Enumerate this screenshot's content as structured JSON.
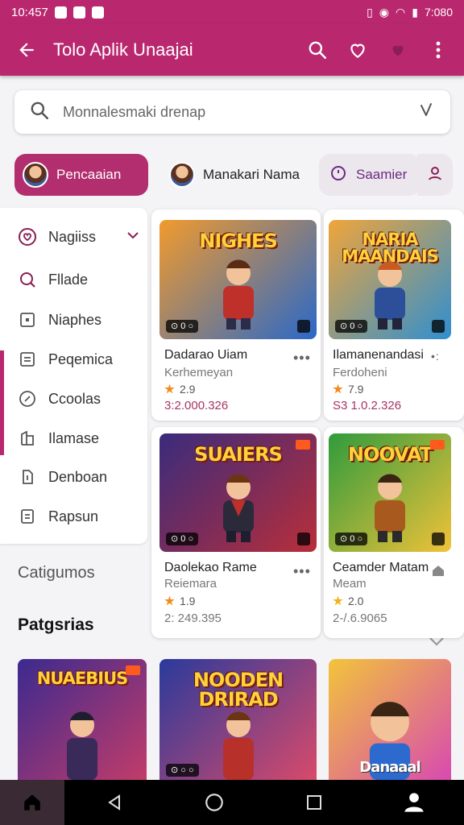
{
  "status": {
    "time": "10:457",
    "right_text": "7:080"
  },
  "appbar": {
    "title": "Tolo Aplik Unaajai",
    "icons": [
      "back-arrow-icon",
      "search-icon",
      "heart-icon",
      "heart-badge-icon",
      "more-vert-icon"
    ]
  },
  "search": {
    "value": "Monnalesmaki drenap",
    "icon": "search-icon",
    "mic_icon": "mic-icon"
  },
  "chips": [
    {
      "label": "Pencaaian",
      "selected": true
    },
    {
      "label": "Manakari Nama",
      "selected": false
    },
    {
      "label": "Saamier",
      "selected": false
    }
  ],
  "sidebar": {
    "items": [
      {
        "label": "Nagiiss",
        "icon": "heart-circle-icon",
        "expandable": true
      },
      {
        "label": "Fllade",
        "icon": "magnifier-icon"
      },
      {
        "label": "Niaphes",
        "icon": "square-icon"
      },
      {
        "label": "Peqemica",
        "icon": "list-box-icon"
      },
      {
        "label": "Ccoolas",
        "icon": "compass-icon"
      },
      {
        "label": "Ilamase",
        "icon": "building-icon"
      },
      {
        "label": "Denboan",
        "icon": "doc-icon"
      },
      {
        "label": "Rapsun",
        "icon": "receipt-icon"
      }
    ]
  },
  "sections": {
    "categories": "Catigumos",
    "popular": "Patgsrias"
  },
  "games": [
    {
      "thumb_title": "NIGHES",
      "name": "Dadarao Uiam",
      "sub": "Kerhemeyan",
      "rating": "2.9",
      "price": "3:2.000.326",
      "badge": "⊙ 0 ○",
      "colors": [
        "#f29a2c",
        "#2a68c9"
      ]
    },
    {
      "thumb_title": "NARIA MAANDAIS",
      "name": "Ilamanenandasi",
      "sub": "Ferdoheni",
      "rating": "7.9",
      "price": "S3 1.0.2.326",
      "badge": "⊙ 0 ○",
      "colors": [
        "#f0a53a",
        "#2f8fd1"
      ]
    },
    {
      "thumb_title": "SUAIERS",
      "name": "Daolekao Rame",
      "sub": "Reiemara",
      "rating": "1.9",
      "price": "2: 249.395",
      "badge": "⊙ 0 ○",
      "colors": [
        "#3a2b7c",
        "#b82e3a"
      ]
    },
    {
      "thumb_title": "NOOVAT",
      "name": "Ceamder Matam",
      "sub": "Meam",
      "rating": "2.0",
      "price": "2-/.6.9065",
      "badge": "⊙ 0 ○",
      "colors": [
        "#2f9b3c",
        "#f0c23a"
      ]
    },
    {
      "thumb_title": "NUAEBIUS",
      "colors": [
        "#3b2a8f",
        "#c23c6a"
      ]
    },
    {
      "thumb_title": "NOODEN DRIRAD",
      "colors": [
        "#2a3a9c",
        "#d84a6a"
      ]
    },
    {
      "thumb_title": "Danaaal",
      "colors": [
        "#f2c43a",
        "#d84ab0"
      ]
    }
  ],
  "navbar": {
    "icons": [
      "home-icon",
      "nav-back-icon",
      "nav-home-circle-icon",
      "nav-recents-icon",
      "profile-icon"
    ]
  },
  "colors": {
    "primary": "#b9286f",
    "accent_text": "#a83363",
    "star": "#f28b1e"
  }
}
